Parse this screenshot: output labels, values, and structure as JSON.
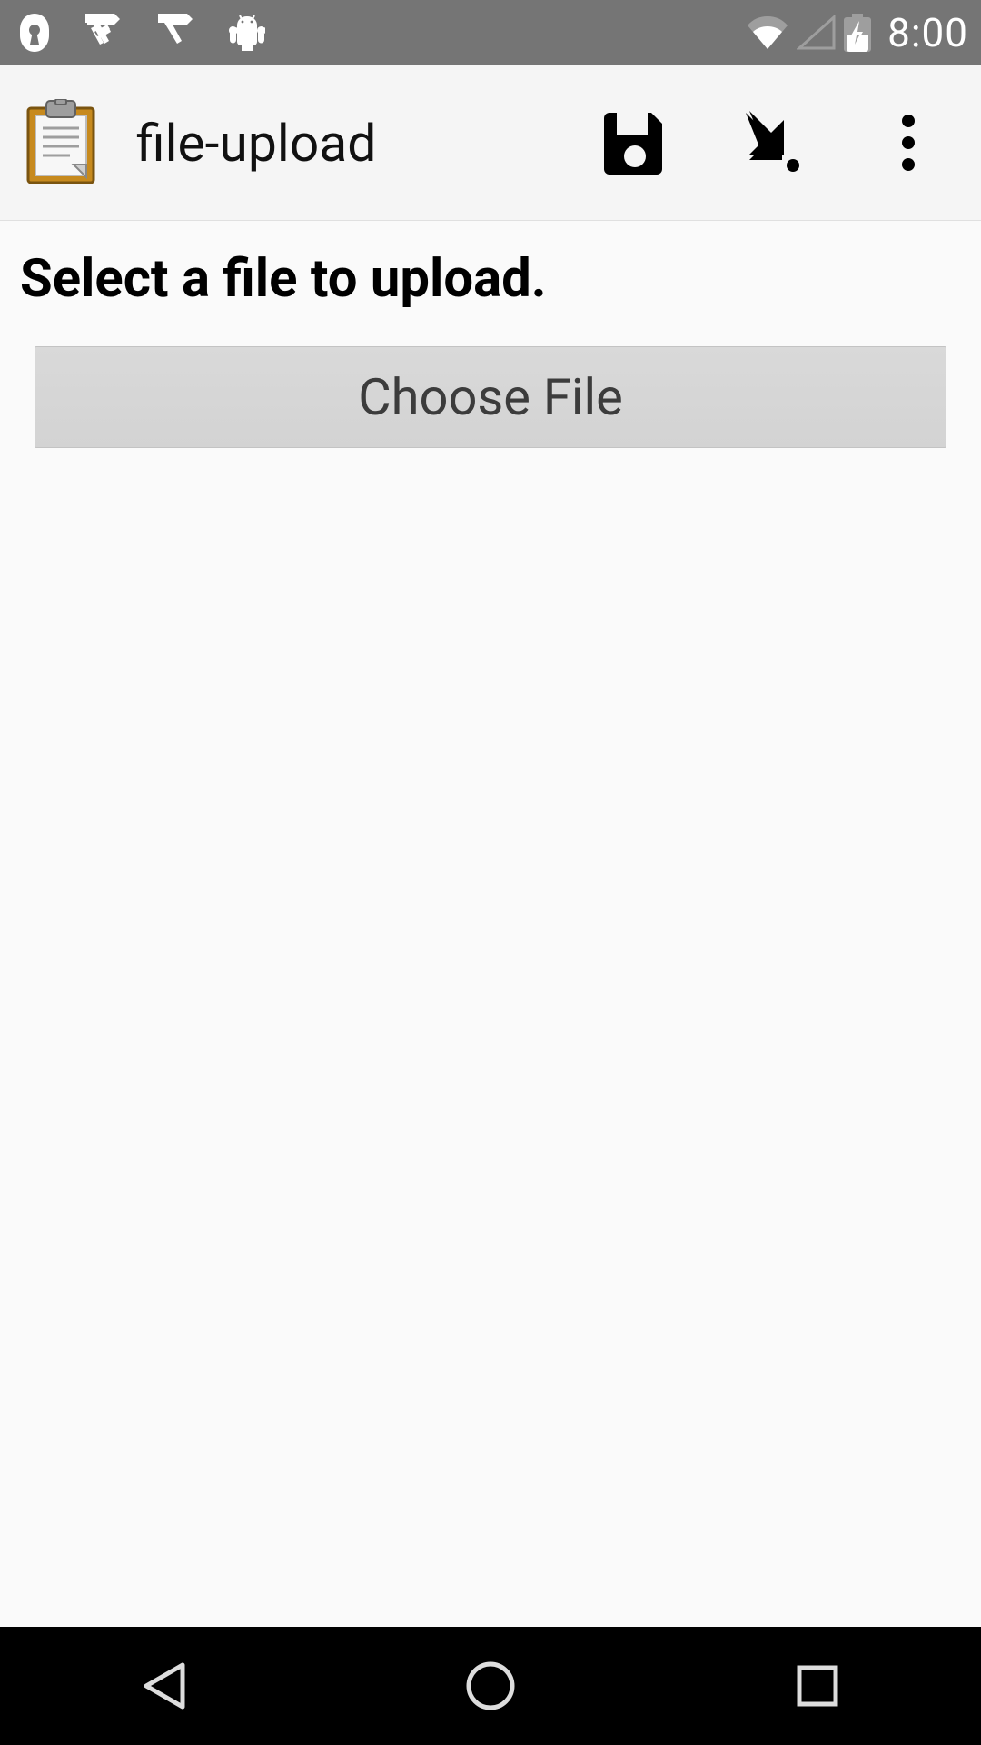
{
  "status_bar": {
    "time": "8:00",
    "icons_left": [
      "lock-keyhole-icon",
      "checkmark-badge-icon",
      "checkmark-badge-icon",
      "android-icon"
    ],
    "icons_right": [
      "wifi-icon",
      "cell-signal-icon",
      "battery-charging-icon"
    ]
  },
  "app_bar": {
    "title": "file-upload",
    "app_icon": "clipboard-icon",
    "actions": [
      {
        "name": "save-icon"
      },
      {
        "name": "download-arrow-icon"
      },
      {
        "name": "more-vert-icon"
      }
    ]
  },
  "main": {
    "heading": "Select a file to upload.",
    "choose_button_label": "Choose File"
  },
  "nav": {
    "back": "nav-back-icon",
    "home": "nav-home-icon",
    "recent": "nav-recent-icon"
  }
}
